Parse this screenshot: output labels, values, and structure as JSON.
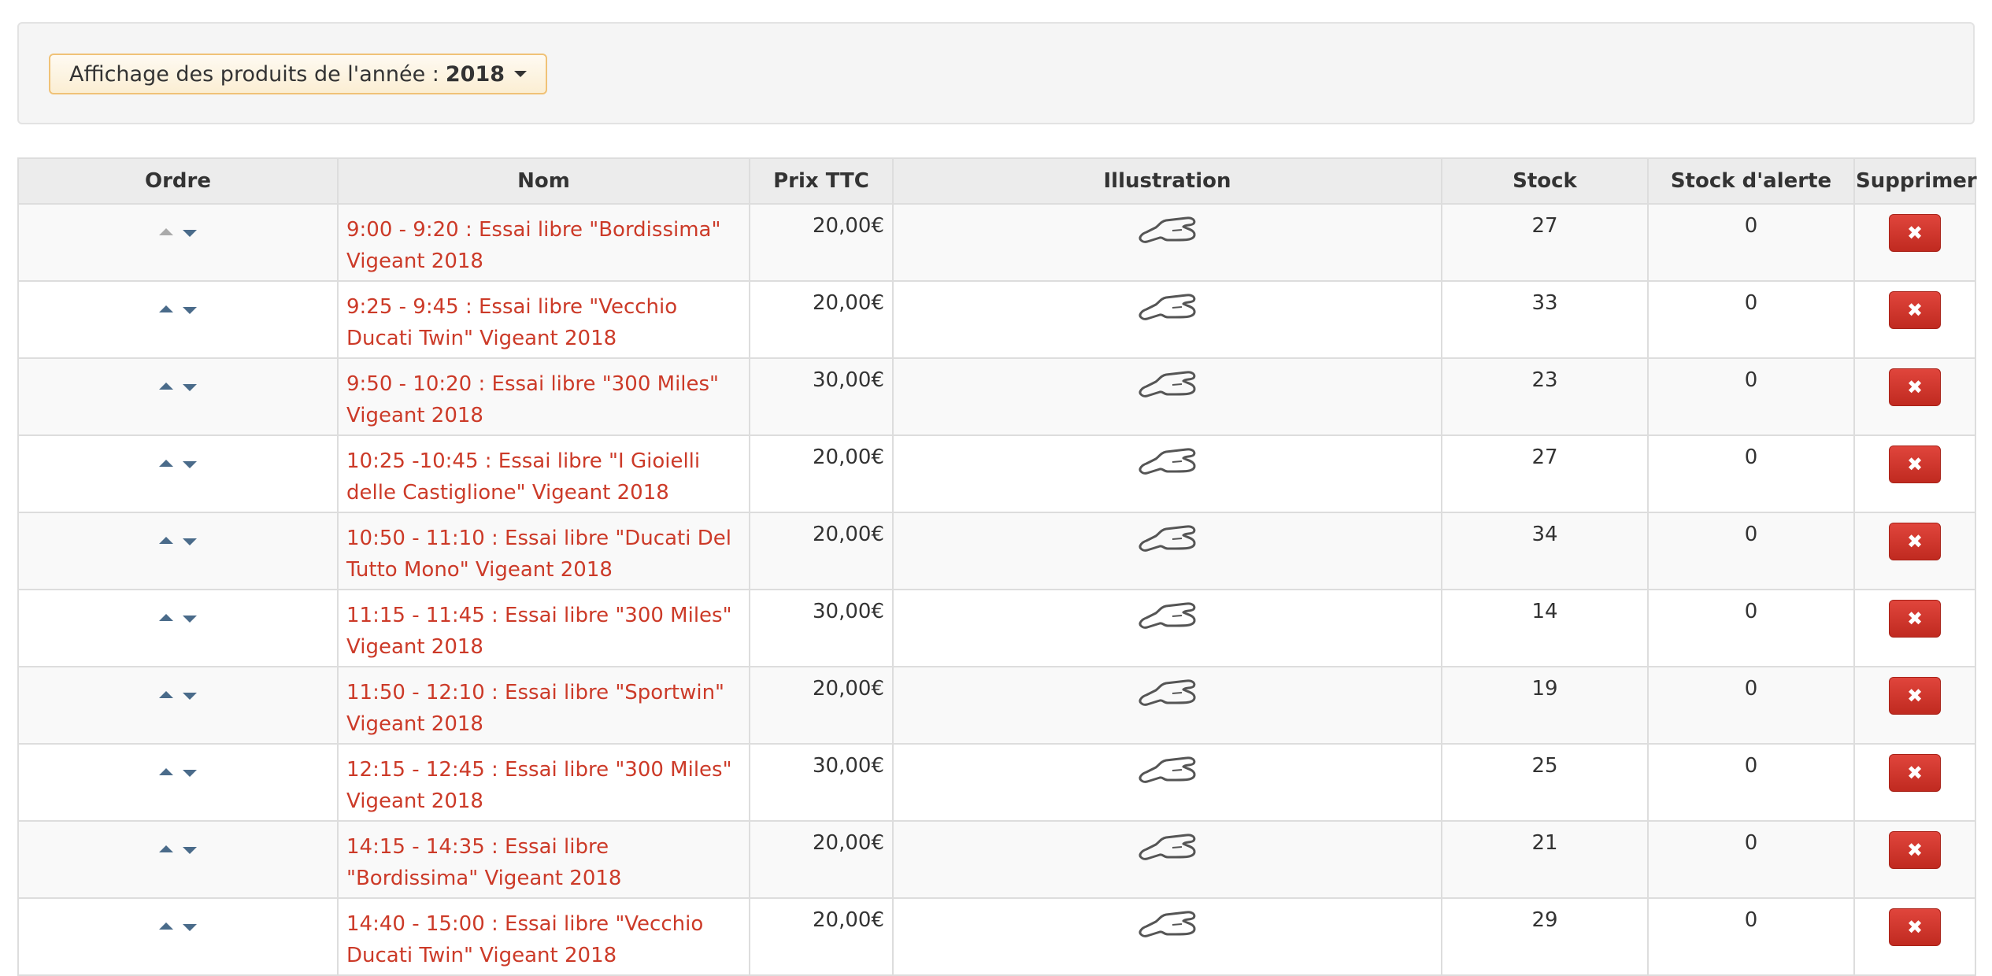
{
  "filter": {
    "label": "Affichage des produits de l'année : ",
    "year": "2018"
  },
  "table": {
    "headers": {
      "ordre": "Ordre",
      "nom": "Nom",
      "prix": "Prix TTC",
      "illustration": "Illustration",
      "stock": "Stock",
      "alerte": "Stock d'alerte",
      "supprimer": "Supprimer"
    },
    "rows": [
      {
        "nom": "9:00 - 9:20 : Essai libre \"Bordissima\" Vigeant 2018",
        "prix": "20,00€",
        "stock": "27",
        "alerte": "0"
      },
      {
        "nom": "9:25 - 9:45 : Essai libre \"Vecchio Ducati Twin\" Vigeant 2018",
        "prix": "20,00€",
        "stock": "33",
        "alerte": "0"
      },
      {
        "nom": "9:50 - 10:20 : Essai libre \"300 Miles\" Vigeant 2018",
        "prix": "30,00€",
        "stock": "23",
        "alerte": "0"
      },
      {
        "nom": "10:25 -10:45 : Essai libre \"I Gioielli delle Castiglione\" Vigeant 2018",
        "prix": "20,00€",
        "stock": "27",
        "alerte": "0"
      },
      {
        "nom": "10:50 - 11:10 : Essai libre \"Ducati Del Tutto Mono\" Vigeant 2018",
        "prix": "20,00€",
        "stock": "34",
        "alerte": "0"
      },
      {
        "nom": "11:15 - 11:45 : Essai libre \"300 Miles\" Vigeant 2018",
        "prix": "30,00€",
        "stock": "14",
        "alerte": "0"
      },
      {
        "nom": "11:50 - 12:10 : Essai libre \"Sportwin\" Vigeant 2018",
        "prix": "20,00€",
        "stock": "19",
        "alerte": "0"
      },
      {
        "nom": "12:15 - 12:45 : Essai libre \"300 Miles\" Vigeant 2018",
        "prix": "30,00€",
        "stock": "25",
        "alerte": "0"
      },
      {
        "nom": "14:15 - 14:35 : Essai libre \"Bordissima\" Vigeant 2018",
        "prix": "20,00€",
        "stock": "21",
        "alerte": "0"
      },
      {
        "nom": "14:40 - 15:00 : Essai libre \"Vecchio Ducati Twin\" Vigeant 2018",
        "prix": "20,00€",
        "stock": "29",
        "alerte": "0"
      }
    ]
  },
  "icons": {
    "order_up": "arrow-up-icon",
    "order_down": "arrow-down-icon",
    "illustration": "race-track-icon",
    "delete": "close-icon"
  },
  "colors": {
    "link": "#cc3a28",
    "delete_button": "#d23a2f",
    "year_button_border": "#f0c277"
  }
}
